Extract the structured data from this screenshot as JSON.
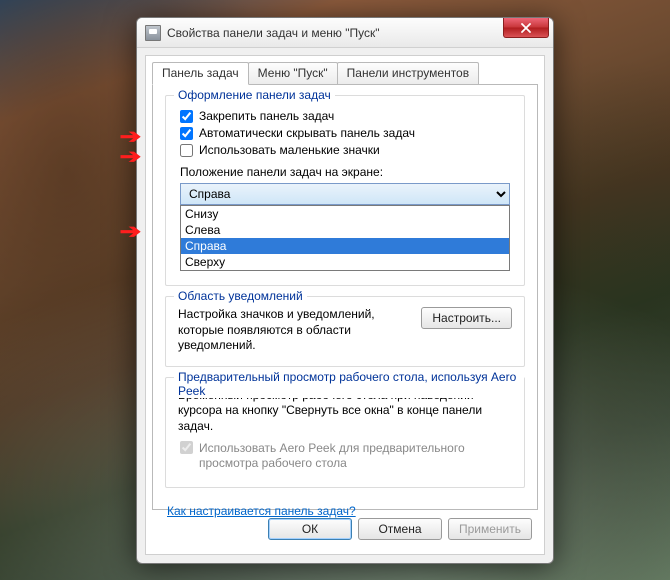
{
  "window": {
    "title": "Свойства панели задач и меню \"Пуск\"",
    "close_icon": "close-icon"
  },
  "tabs": {
    "items": [
      {
        "label": "Панель задач",
        "active": true
      },
      {
        "label": "Меню \"Пуск\"",
        "active": false
      },
      {
        "label": "Панели инструментов",
        "active": false
      }
    ]
  },
  "appearance": {
    "group_title": "Оформление панели задач",
    "lock": {
      "label": "Закрепить панель задач",
      "checked": true
    },
    "autohide": {
      "label": "Автоматически скрывать панель задач",
      "checked": true
    },
    "small_icons": {
      "label": "Использовать маленькие значки",
      "checked": false
    },
    "position_label": "Положение панели задач на экране:",
    "position_selected": "Справа",
    "position_options": [
      "Снизу",
      "Слева",
      "Справа",
      "Сверху"
    ]
  },
  "notif": {
    "group_title": "Область уведомлений",
    "text": "Настройка значков и уведомлений, которые появляются в области уведомлений.",
    "button": "Настроить..."
  },
  "aero": {
    "group_title": "Предварительный просмотр рабочего стола, используя Aero Peek",
    "text": "Временный просмотр рабочего стола при наведении курсора на кнопку \"Свернуть все окна\" в конце панели задач.",
    "checkbox_label": "Использовать Aero Peek для предварительного просмотра рабочего стола",
    "checkbox_checked": true,
    "checkbox_enabled": false
  },
  "help_link": "Как настраивается панель задач?",
  "buttons": {
    "ok": "ОК",
    "cancel": "Отмена",
    "apply": "Применить"
  }
}
